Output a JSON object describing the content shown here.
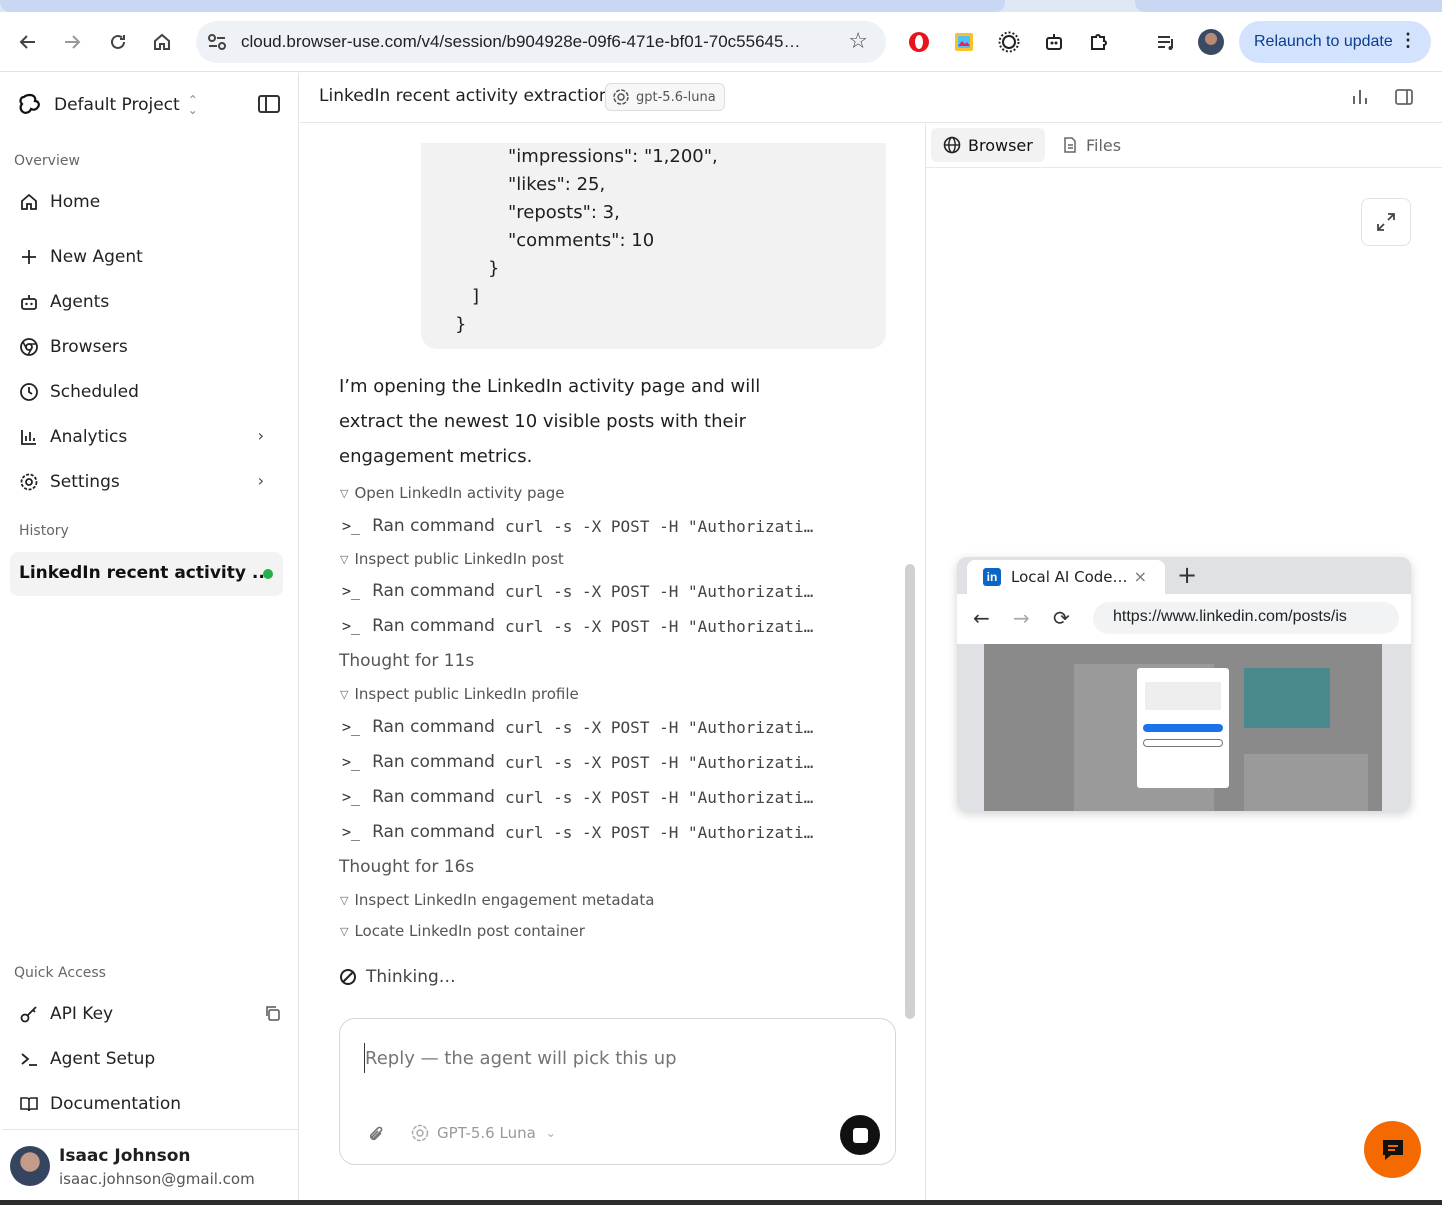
{
  "browser": {
    "url": "cloud.browser-use.com/v4/session/b904928e-09f6-471e-bf01-70c55645…",
    "relaunch_label": "Relaunch to update"
  },
  "sidebar": {
    "project_name": "Default Project",
    "overview_label": "Overview",
    "nav": {
      "home": "Home",
      "new_agent": "New Agent",
      "agents": "Agents",
      "browsers": "Browsers",
      "scheduled": "Scheduled",
      "analytics": "Analytics",
      "settings": "Settings"
    },
    "history_label": "History",
    "history_item": "LinkedIn recent activity ...",
    "quick_access_label": "Quick Access",
    "quick": {
      "api_key": "API Key",
      "agent_setup": "Agent Setup",
      "documentation": "Documentation"
    },
    "user": {
      "name": "Isaac Johnson",
      "email": "isaac.johnson@gmail.com"
    }
  },
  "header": {
    "title": "LinkedIn recent activity extraction",
    "model": "gpt-5.6-luna"
  },
  "chat": {
    "code_lines": {
      "l1": "\"impressions\": \"1,200\",",
      "l2": "\"likes\": 25,",
      "l3": "\"reposts\": 3,",
      "l4": "\"comments\": 10",
      "l5": "}",
      "l6": "]",
      "l7": "}"
    },
    "message": "I’m opening the LinkedIn activity page and will extract the newest 10 visible posts with their engagement metrics.",
    "steps": {
      "s1": "Open LinkedIn activity page",
      "s2": "Inspect public LinkedIn post",
      "s3": "Inspect public LinkedIn profile",
      "s4": "Inspect LinkedIn engagement metadata",
      "s5": "Locate LinkedIn post container"
    },
    "cmd_label": "Ran command",
    "cmd_text": "curl -s -X POST -H \"Authorizati…",
    "thought1": "Thought for 11s",
    "thought2": "Thought for 16s",
    "thinking": "Thinking…",
    "composer": {
      "placeholder": "Reply — the agent will pick this up",
      "model": "GPT-5.6 Luna"
    }
  },
  "right_panel": {
    "tab_browser": "Browser",
    "tab_files": "Files",
    "mini_browser": {
      "tab_title": "Local AI Code…",
      "url": "https://www.linkedin.com/posts/is"
    }
  }
}
